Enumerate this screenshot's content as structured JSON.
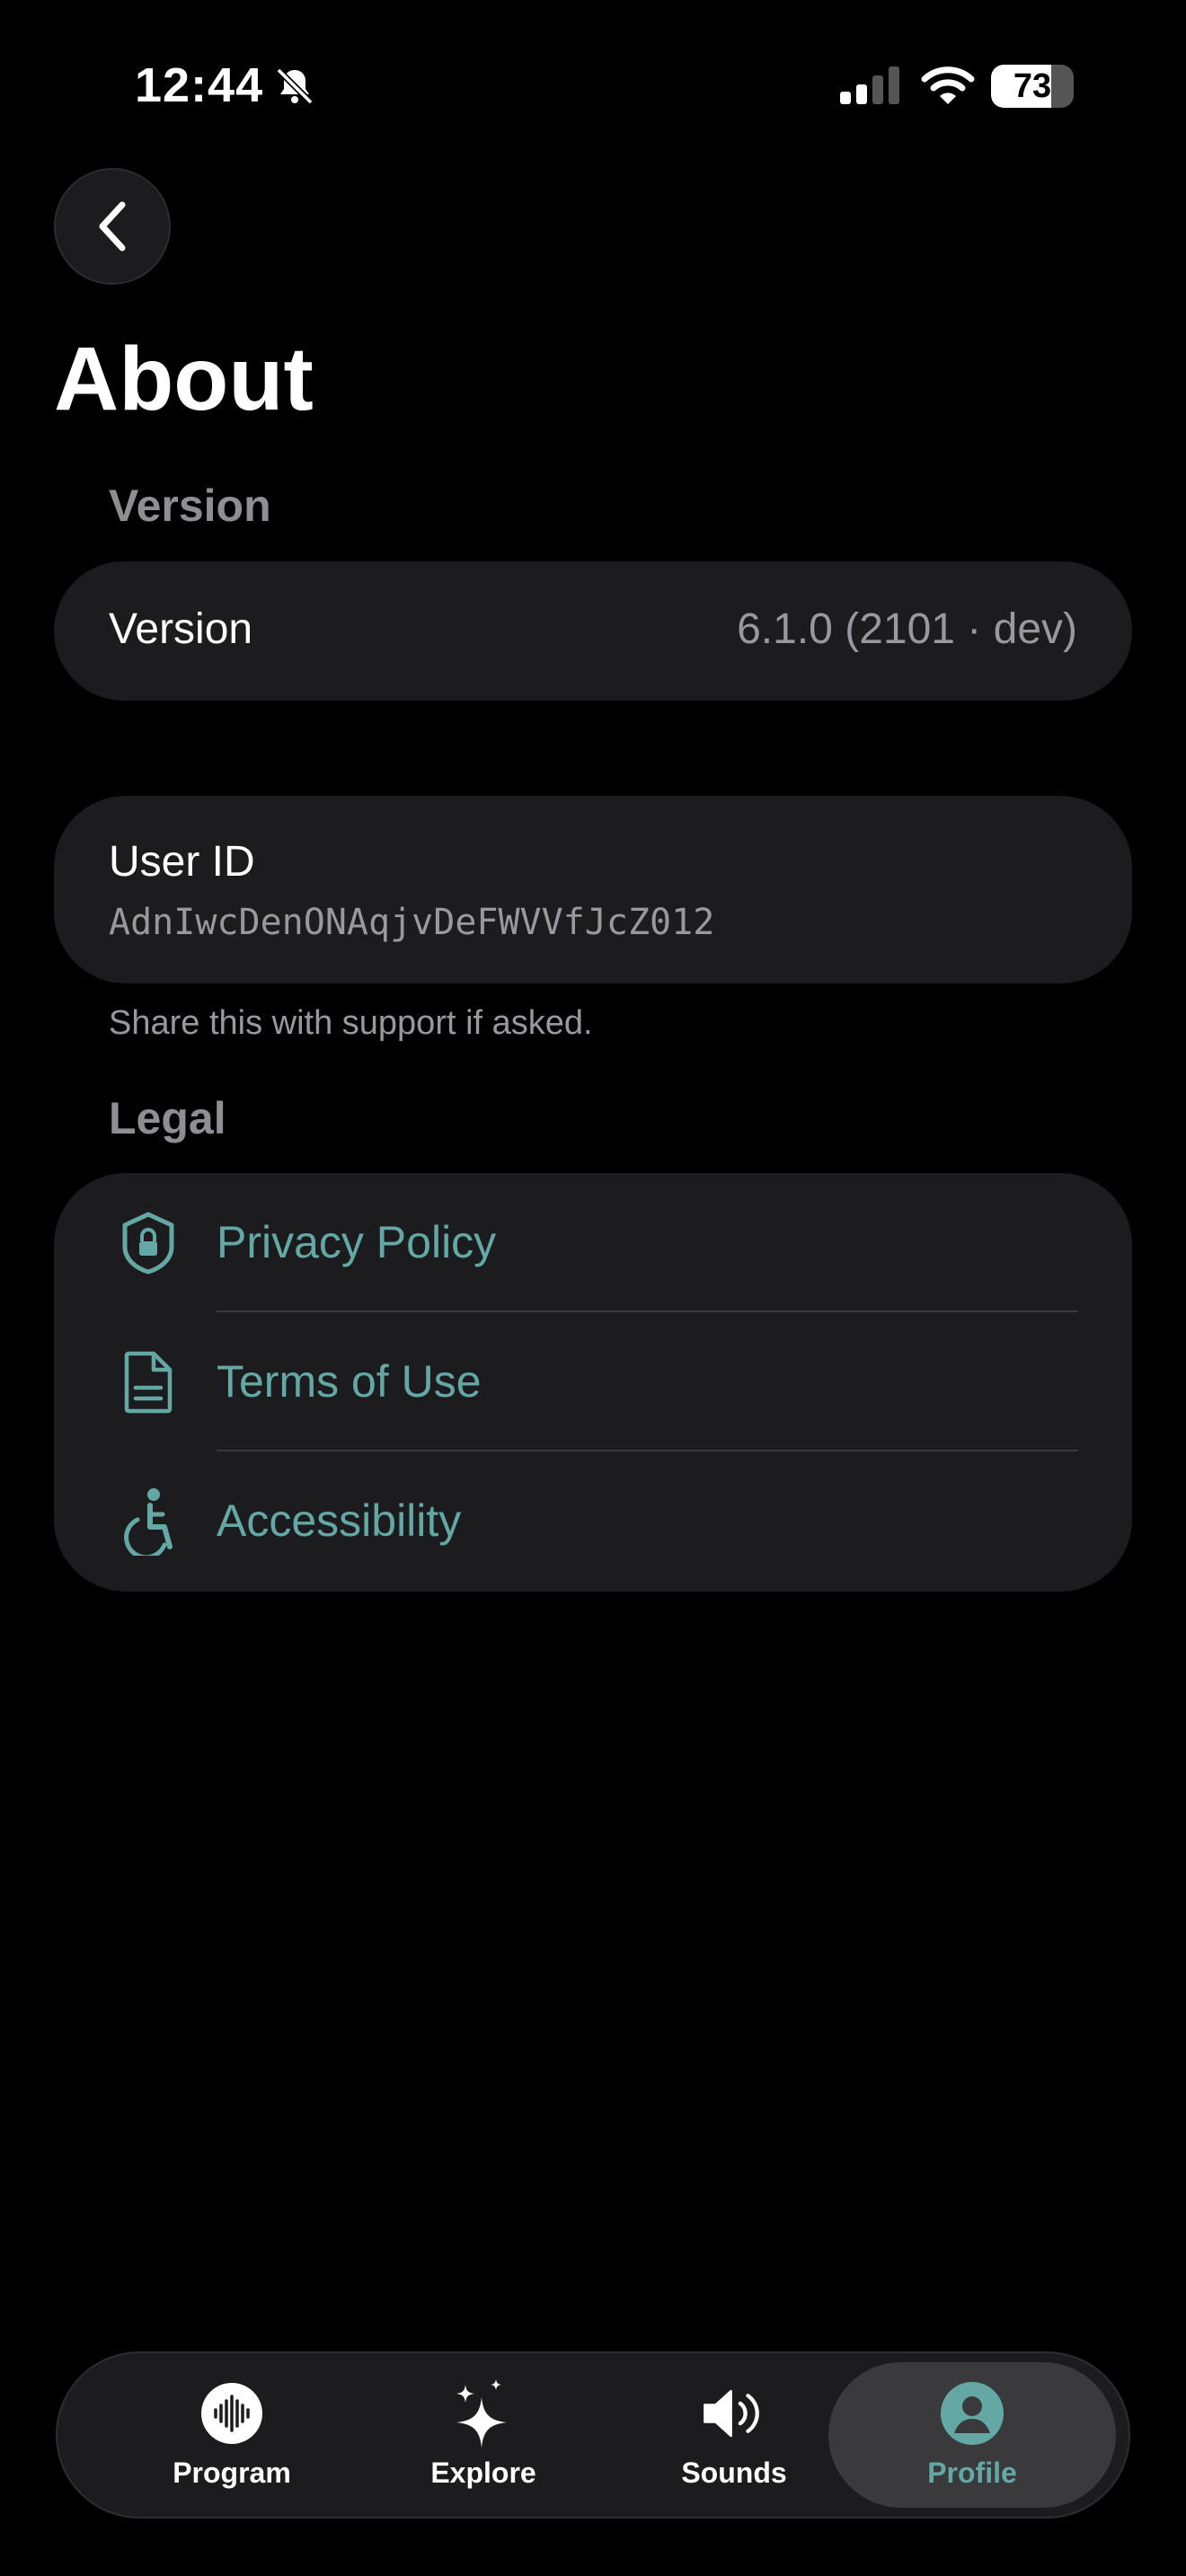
{
  "status_bar": {
    "time": "12:44",
    "battery_percent": 73,
    "battery_label": "73"
  },
  "header": {
    "title": "About"
  },
  "version_section": {
    "label": "Version",
    "row_label": "Version",
    "row_value": "6.1.0 (2101 · dev)"
  },
  "user_section": {
    "label": "User ID",
    "value": "AdnIwcDenONAqjvDeFWVVfJcZ012",
    "footnote": "Share this with support if asked."
  },
  "legal_section": {
    "label": "Legal",
    "items": [
      {
        "label": "Privacy Policy",
        "icon": "shield-lock-icon"
      },
      {
        "label": "Terms of Use",
        "icon": "document-icon"
      },
      {
        "label": "Accessibility",
        "icon": "accessibility-icon"
      }
    ]
  },
  "tabbar": {
    "active": "Profile",
    "tabs": [
      {
        "label": "Program",
        "icon": "waveform-icon"
      },
      {
        "label": "Explore",
        "icon": "sparkles-icon"
      },
      {
        "label": "Sounds",
        "icon": "speaker-icon"
      },
      {
        "label": "Profile",
        "icon": "person-icon"
      }
    ]
  },
  "colors": {
    "accent": "#64a8a6",
    "card": "#1c1c1e",
    "background": "#000000",
    "secondary_text": "#98989d"
  }
}
